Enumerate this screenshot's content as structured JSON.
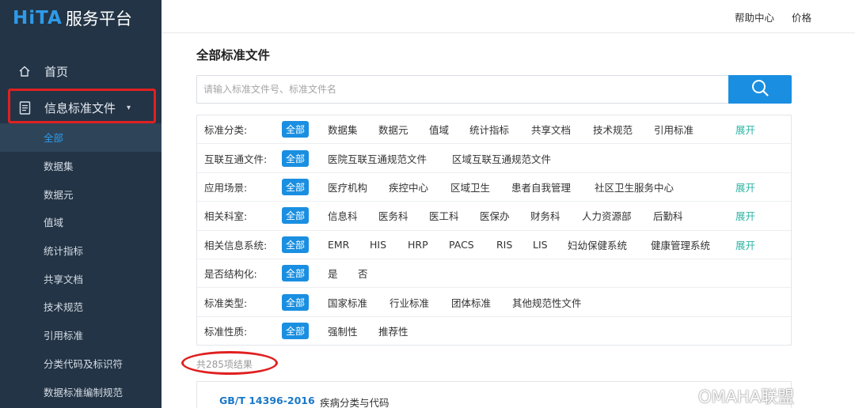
{
  "brand": {
    "mark": "HiTA",
    "name": "服务平台"
  },
  "topbar": {
    "help": "帮助中心",
    "price": "价格"
  },
  "sidebar": {
    "home": "首页",
    "standards": "信息标准文件",
    "subitems": [
      "全部",
      "数据集",
      "数据元",
      "值域",
      "统计指标",
      "共享文档",
      "技术规范",
      "引用标准",
      "分类代码及标识符",
      "数据标准编制规范"
    ]
  },
  "main": {
    "title": "全部标准文件",
    "search_placeholder": "请输入标准文件号、标准文件名",
    "filters": [
      {
        "label": "标准分类:",
        "options": [
          "全部",
          "数据集",
          "数据元",
          "值域",
          "统计指标",
          "共享文档",
          "技术规范",
          "引用标准"
        ],
        "expand": "展开"
      },
      {
        "label": "互联互通文件:",
        "options": [
          "全部",
          "医院互联互通规范文件",
          "区域互联互通规范文件"
        ],
        "expand": ""
      },
      {
        "label": "应用场景:",
        "options": [
          "全部",
          "医疗机构",
          "疾控中心",
          "区域卫生",
          "患者自我管理",
          "社区卫生服务中心"
        ],
        "expand": "展开"
      },
      {
        "label": "相关科室:",
        "options": [
          "全部",
          "信息科",
          "医务科",
          "医工科",
          "医保办",
          "财务科",
          "人力资源部",
          "后勤科"
        ],
        "expand": "展开"
      },
      {
        "label": "相关信息系统:",
        "options": [
          "全部",
          "EMR",
          "HIS",
          "HRP",
          "PACS",
          "RIS",
          "LIS",
          "妇幼保健系统",
          "健康管理系统"
        ],
        "expand": "展开"
      },
      {
        "label": "是否结构化:",
        "options": [
          "全部",
          "是",
          "否"
        ],
        "expand": ""
      },
      {
        "label": "标准类型:",
        "options": [
          "全部",
          "国家标准",
          "行业标准",
          "团体标准",
          "其他规范性文件"
        ],
        "expand": ""
      },
      {
        "label": "标准性质:",
        "options": [
          "全部",
          "强制性",
          "推荐性"
        ],
        "expand": ""
      }
    ],
    "result_count": "共285项结果",
    "results": [
      {
        "code": "GB/T 14396-2016",
        "title": "疾病分类与代码"
      }
    ]
  },
  "watermark": "OMAHA联盟",
  "colors": {
    "sidebar_bg": "#233446",
    "accent": "#1a8fe1",
    "expand": "#2fb5a5",
    "highlight": "#e02020"
  }
}
